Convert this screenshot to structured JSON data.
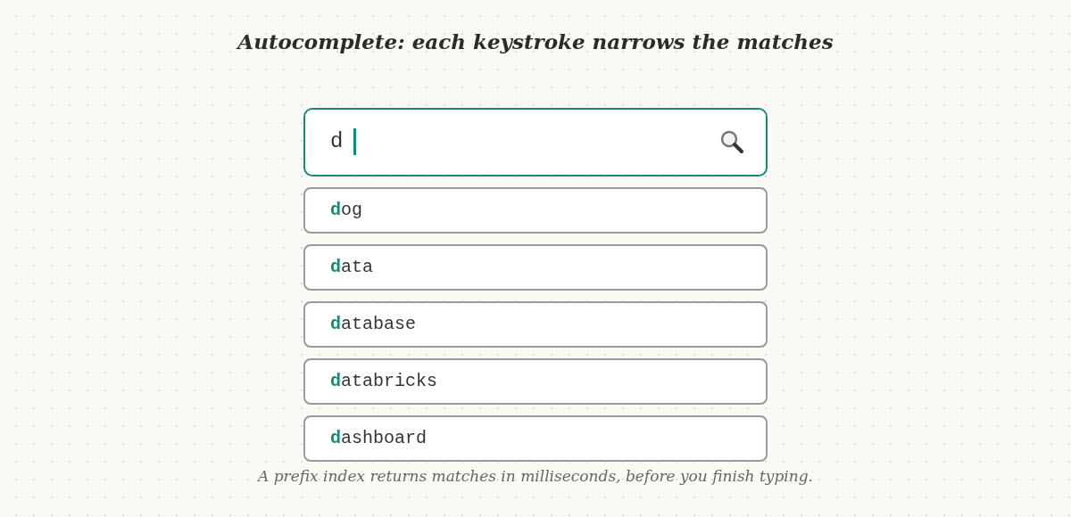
{
  "title": "Autocomplete: each keystroke narrows the matches",
  "search": {
    "value": "d"
  },
  "suggestions": [
    {
      "match": "d",
      "rest": "og"
    },
    {
      "match": "d",
      "rest": "ata"
    },
    {
      "match": "d",
      "rest": "atabase"
    },
    {
      "match": "d",
      "rest": "atabricks"
    },
    {
      "match": "d",
      "rest": "ashboard"
    }
  ],
  "caption": "A prefix index returns matches in milliseconds, before you finish typing."
}
